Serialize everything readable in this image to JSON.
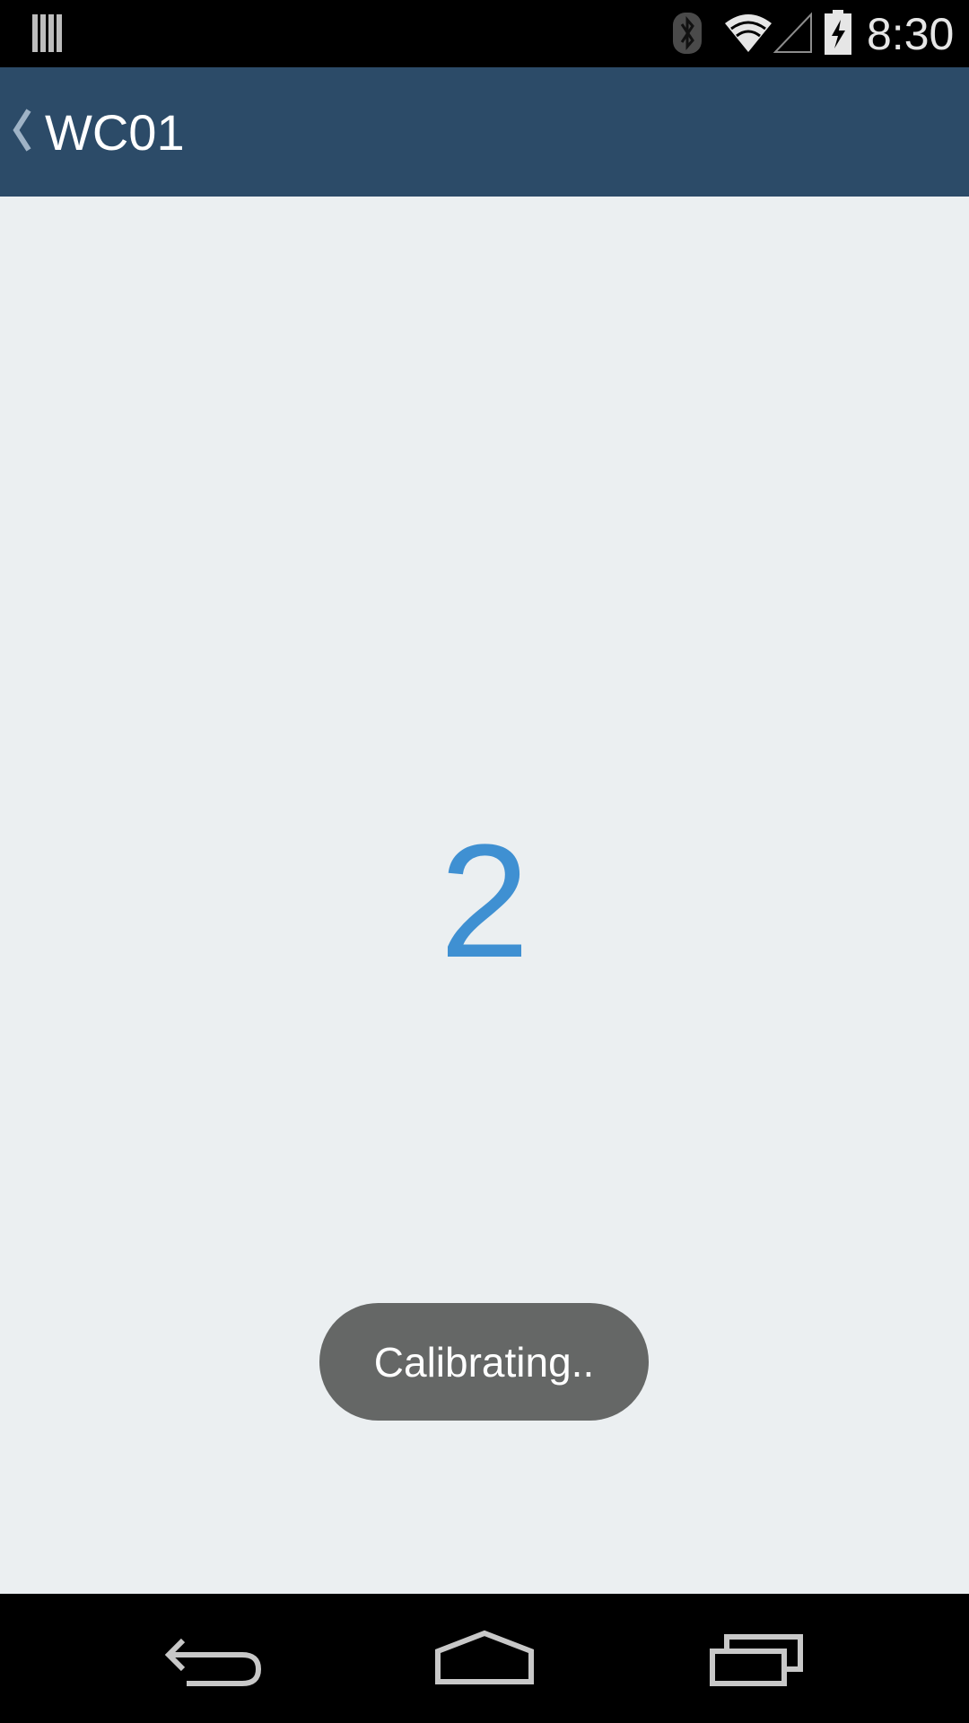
{
  "status_bar": {
    "time": "8:30",
    "icons": [
      "notification-bars-icon",
      "bluetooth-icon",
      "wifi-icon",
      "cell-signal-icon",
      "battery-charging-icon"
    ]
  },
  "app_bar": {
    "title": "WC01",
    "back_icon": "chevron-left-icon"
  },
  "main": {
    "countdown_value": "2"
  },
  "toast": {
    "message": "Calibrating.."
  },
  "nav_bar": {
    "buttons": [
      "back-icon",
      "home-icon",
      "recents-icon"
    ]
  },
  "colors": {
    "app_bar": "#2c4b68",
    "background": "#ebeff1",
    "countdown": "#3f90d2",
    "toast": "#656766"
  }
}
